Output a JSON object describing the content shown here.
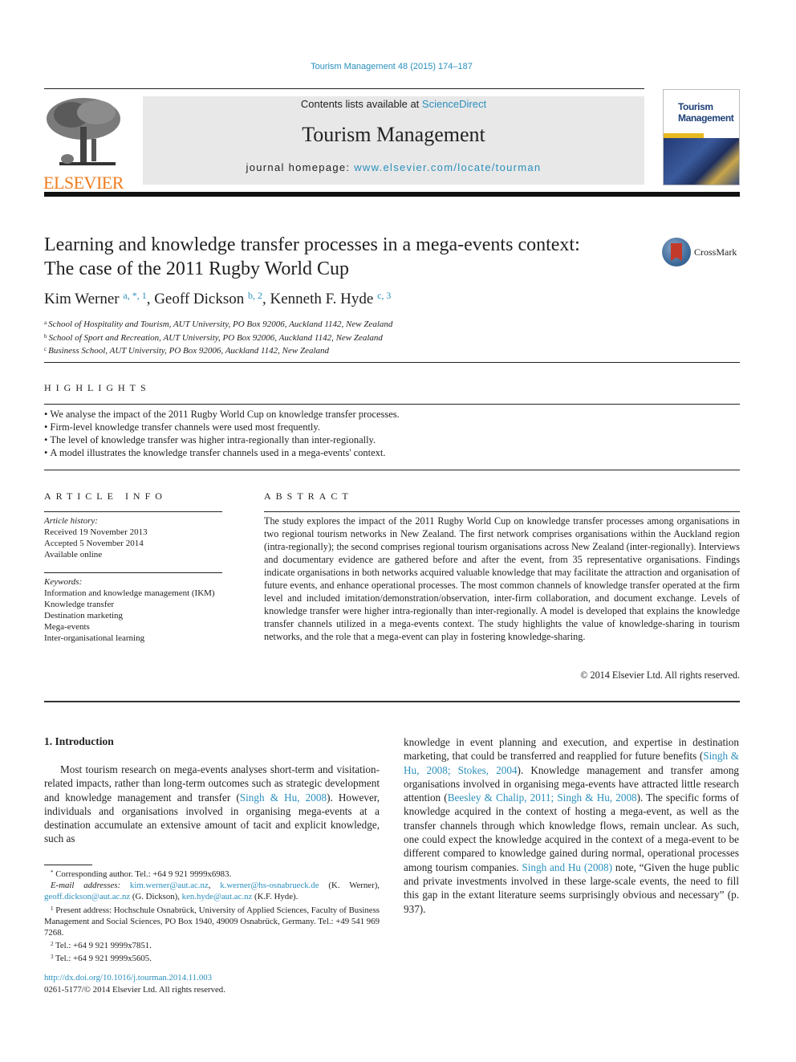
{
  "header": {
    "journal_reference": "Tourism Management 48 (2015) 174–187",
    "publisher_name": "ELSEVIER",
    "contents_prefix": "Contents lists available at ",
    "contents_link": "ScienceDirect",
    "journal_title": "Tourism Management",
    "homepage_prefix": "journal homepage: ",
    "homepage_link": "www.elsevier.com/locate/tourman",
    "cover_title_line1": "Tourism",
    "cover_title_line2": "Management",
    "crossmark_label": "CrossMark"
  },
  "article": {
    "title_line1": "Learning and knowledge transfer processes in a mega-events context:",
    "title_line2": "The case of the 2011 Rugby World Cup",
    "authors": [
      {
        "name": "Kim Werner",
        "marks": "a, *, 1"
      },
      {
        "name": "Geoff Dickson",
        "marks": "b, 2"
      },
      {
        "name": "Kenneth F. Hyde",
        "marks": "c, 3"
      }
    ],
    "affiliations": [
      {
        "mark": "a",
        "text": "School of Hospitality and Tourism, AUT University, PO Box 92006, Auckland 1142, New Zealand"
      },
      {
        "mark": "b",
        "text": "School of Sport and Recreation, AUT University, PO Box 92006, Auckland 1142, New Zealand"
      },
      {
        "mark": "c",
        "text": "Business School, AUT University, PO Box 92006, Auckland 1142, New Zealand"
      }
    ]
  },
  "highlights": {
    "heading": "HIGHLIGHTS",
    "items": [
      "We analyse the impact of the 2011 Rugby World Cup on knowledge transfer processes.",
      "Firm-level knowledge transfer channels were used most frequently.",
      "The level of knowledge transfer was higher intra-regionally than inter-regionally.",
      "A model illustrates the knowledge transfer channels used in a mega-events' context."
    ]
  },
  "article_info": {
    "heading": "ARTICLE INFO",
    "history_label": "Article history:",
    "history": [
      "Received 19 November 2013",
      "Accepted 5 November 2014",
      "Available online"
    ],
    "keywords_label": "Keywords:",
    "keywords": [
      "Information and knowledge management (IKM)",
      "Knowledge transfer",
      "Destination marketing",
      "Mega-events",
      "Inter-organisational learning"
    ]
  },
  "abstract": {
    "heading": "ABSTRACT",
    "body": "The study explores the impact of the 2011 Rugby World Cup on knowledge transfer processes among organisations in two regional tourism networks in New Zealand. The first network comprises organisations within the Auckland region (intra-regionally); the second comprises regional tourism organisations across New Zealand (inter-regionally). Interviews and documentary evidence are gathered before and after the event, from 35 representative organisations. Findings indicate organisations in both networks acquired valuable knowledge that may facilitate the attraction and organisation of future events, and enhance operational processes. The most common channels of knowledge transfer operated at the firm level and included imitation/demonstration/observation, inter-firm collaboration, and document exchange. Levels of knowledge transfer were higher intra-regionally than inter-regionally. A model is developed that explains the knowledge transfer channels utilized in a mega-events context. The study highlights the value of knowledge-sharing in tourism networks, and the role that a mega-event can play in fostering knowledge-sharing.",
    "copyright": "© 2014 Elsevier Ltd. All rights reserved."
  },
  "introduction": {
    "heading": "1.  Introduction",
    "col1_before_cite": "Most tourism research on mega-events analyses short-term and visitation-related impacts, rather than long-term outcomes such as strategic development and knowledge management and transfer (",
    "col1_cite": "Singh & Hu, 2008",
    "col1_after_cite": "). However, individuals and organisations involved in organising mega-events at a destination accumulate an extensive amount of tacit and explicit knowledge, such as",
    "col2_part1": "knowledge in event planning and execution, and expertise in destination marketing, that could be transferred and reapplied for future benefits (",
    "col2_cite1": "Singh & Hu, 2008; Stokes, 2004",
    "col2_part2": "). Knowledge management and transfer among organisations involved in organising mega-events have attracted little research attention (",
    "col2_cite2": "Beesley & Chalip, 2011; Singh & Hu, 2008",
    "col2_part3": "). The specific forms of knowledge acquired in the context of hosting a mega-event, as well as the transfer channels through which knowledge flows, remain unclear. As such, one could expect the knowledge acquired in the context of a mega-event to be different compared to knowledge gained during normal, operational processes among tourism companies. ",
    "col2_cite3": "Singh and Hu (2008)",
    "col2_part4": " note, “Given the huge public and private investments involved in these large-scale events, the need to fill this gap in the extant literature seems surprisingly obvious and necessary” (p. 937)."
  },
  "footnotes": {
    "corresponding": "Corresponding author. Tel.: +64 9 921 9999x6983.",
    "email_label": "E-mail addresses:",
    "email1": "kim.werner@aut.ac.nz",
    "email2": "k.werner@hs-osnabrueck.de",
    "email2_owner": "(K. Werner),",
    "email3": "geoff.dickson@aut.ac.nz",
    "email3_owner": "(G. Dickson),",
    "email4": "ken.hyde@aut.ac.nz",
    "email4_owner": "(K.F. Hyde).",
    "note1": "Present address: Hochschule Osnabrück, University of Applied Sciences, Faculty of Business Management and Social Sciences, PO Box 1940, 49009 Osnabrück, Germany. Tel.: +49 541 969 7268.",
    "note2": "Tel.: +64 9 921 9999x7851.",
    "note3": "Tel.: +64 9 921 9999x5605.",
    "doi": "http://dx.doi.org/10.1016/j.tourman.2014.11.003",
    "issn_copyright": "0261-5177/© 2014 Elsevier Ltd. All rights reserved."
  }
}
